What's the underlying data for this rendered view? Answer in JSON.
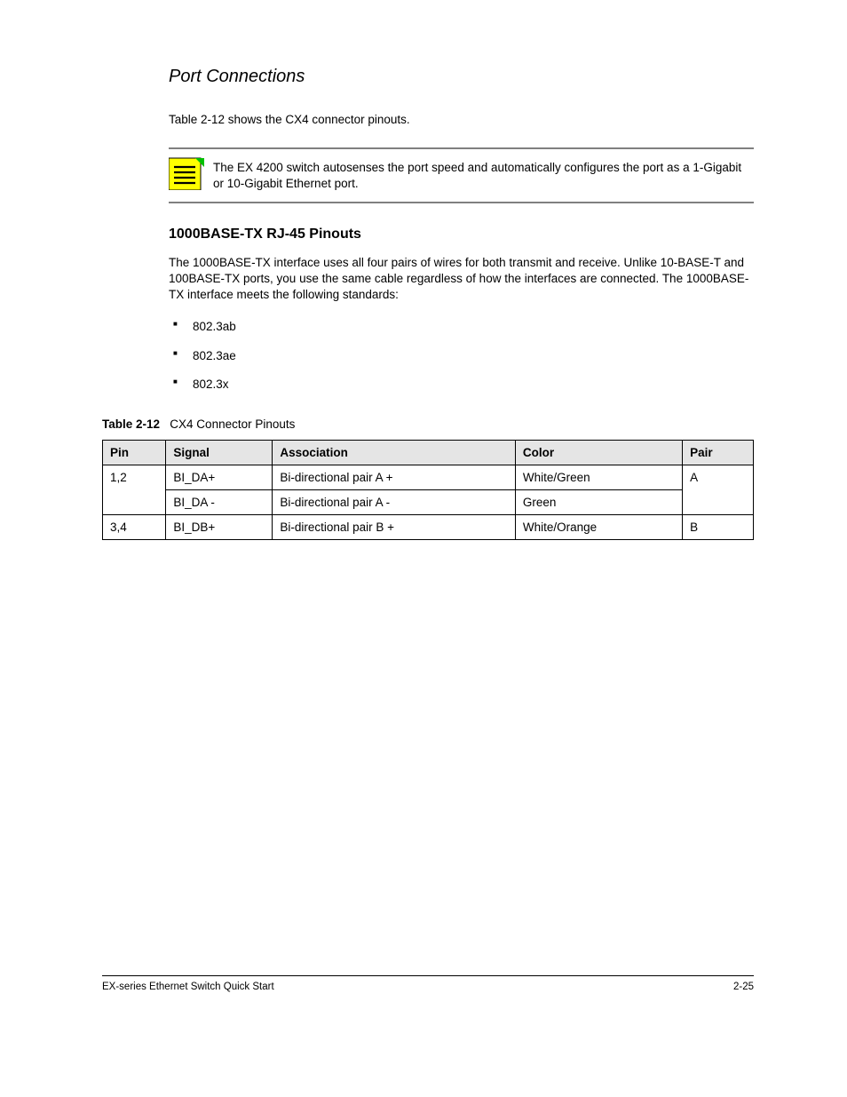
{
  "title": "Port Connections",
  "intro": "Table 2-12 shows the CX4 connector pinouts.",
  "note": "The EX 4200 switch autosenses the port speed and automatically configures the port as a 1-Gigabit or 10-Gigabit Ethernet port.",
  "section_heading": "1000BASE-TX RJ-45 Pinouts",
  "section_body": "The 1000BASE-TX interface uses all four pairs of wires for both transmit and receive. Unlike 10-BASE-T and 100BASE-TX ports, you use the same cable regardless of how the interfaces are connected. The 1000BASE-TX interface meets the following standards:",
  "bullets": [
    "802.3ab",
    "802.3ae",
    "802.3x"
  ],
  "table_caption_num": "Table 2-12",
  "table_caption_title": "CX4 Connector Pinouts",
  "table_headers": [
    "Pin",
    "Signal",
    "Association",
    "Color",
    "Pair"
  ],
  "rows": [
    {
      "pin_group": "1,2",
      "r": [
        {
          "signal": "BI_DA+",
          "assoc": "Bi-directional pair A +",
          "color": "White/Green",
          "pair_group": "A"
        },
        {
          "signal": "BI_DA -",
          "assoc": "Bi-directional pair A -",
          "color": "Green"
        }
      ]
    },
    {
      "pin_group": "3,4",
      "r": [
        {
          "signal": "BI_DB+",
          "assoc": "Bi-directional pair B +",
          "color": "White/Orange",
          "pair_group": "B"
        }
      ]
    }
  ],
  "footer_left": "EX-series Ethernet Switch Quick Start",
  "footer_right": "2-25"
}
